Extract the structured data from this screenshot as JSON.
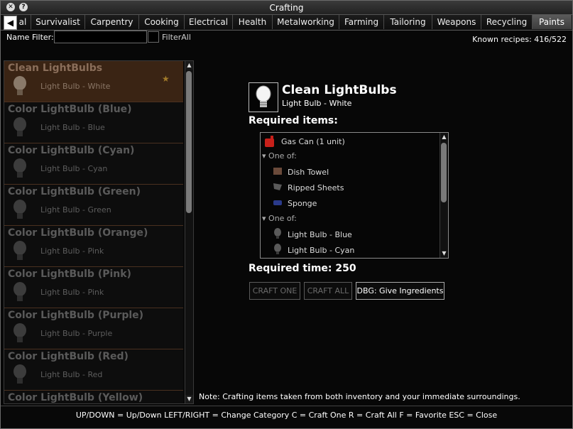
{
  "window": {
    "title": "Crafting"
  },
  "tabs": [
    {
      "label": "al"
    },
    {
      "label": "Survivalist"
    },
    {
      "label": "Carpentry"
    },
    {
      "label": "Cooking"
    },
    {
      "label": "Electrical"
    },
    {
      "label": "Health"
    },
    {
      "label": "Metalworking"
    },
    {
      "label": "Farming"
    },
    {
      "label": "Tailoring"
    },
    {
      "label": "Weapons"
    },
    {
      "label": "Recycling"
    },
    {
      "label": "Paints"
    }
  ],
  "active_tab": "Paints",
  "filter": {
    "label": "Name Filter:",
    "value": "",
    "filter_all_label": "FilterAll"
  },
  "known_recipes": "Known recipes: 416/522",
  "recipes": [
    {
      "name": "Clean LightBulbs",
      "result": "Light Bulb - White",
      "selected": true,
      "favorite": true
    },
    {
      "name": "Color LightBulb (Blue)",
      "result": "Light Bulb - Blue"
    },
    {
      "name": "Color LightBulb (Cyan)",
      "result": "Light Bulb - Cyan"
    },
    {
      "name": "Color LightBulb (Green)",
      "result": "Light Bulb - Green"
    },
    {
      "name": "Color LightBulb (Orange)",
      "result": "Light Bulb - Pink"
    },
    {
      "name": "Color LightBulb (Pink)",
      "result": "Light Bulb - Pink"
    },
    {
      "name": "Color LightBulb (Purple)",
      "result": "Light Bulb - Purple"
    },
    {
      "name": "Color LightBulb (Red)",
      "result": "Light Bulb - Red"
    },
    {
      "name": "Color LightBulb (Yellow)",
      "result": ""
    }
  ],
  "detail": {
    "title": "Clean LightBulbs",
    "subtitle": "Light Bulb - White",
    "required_label": "Required items:",
    "required_items": [
      {
        "text": "Gas Can (1 unit)",
        "type": "item",
        "icon": "gas-can-icon"
      },
      {
        "text": "One of:",
        "type": "oneof"
      },
      {
        "text": "Dish Towel",
        "type": "option",
        "icon": "dish-towel-icon"
      },
      {
        "text": "Ripped Sheets",
        "type": "option",
        "icon": "ripped-sheets-icon"
      },
      {
        "text": "Sponge",
        "type": "option",
        "icon": "sponge-icon"
      },
      {
        "text": "One of:",
        "type": "oneof"
      },
      {
        "text": "Light Bulb - Blue",
        "type": "option",
        "icon": "lightbulb-icon"
      },
      {
        "text": "Light Bulb - Cyan",
        "type": "option",
        "icon": "lightbulb-icon"
      }
    ],
    "required_time": "Required time: 250",
    "buttons": {
      "craft_one": "CRAFT ONE",
      "craft_all": "CRAFT ALL",
      "give_ingredients": "DBG: Give Ingredients"
    }
  },
  "note": "Note: Crafting items taken from both inventory and your immediate surroundings.",
  "footer_hint": "UP/DOWN = Up/Down   LEFT/RIGHT = Change Category   C = Craft One   R = Craft All   F = Favorite   ESC = Close"
}
